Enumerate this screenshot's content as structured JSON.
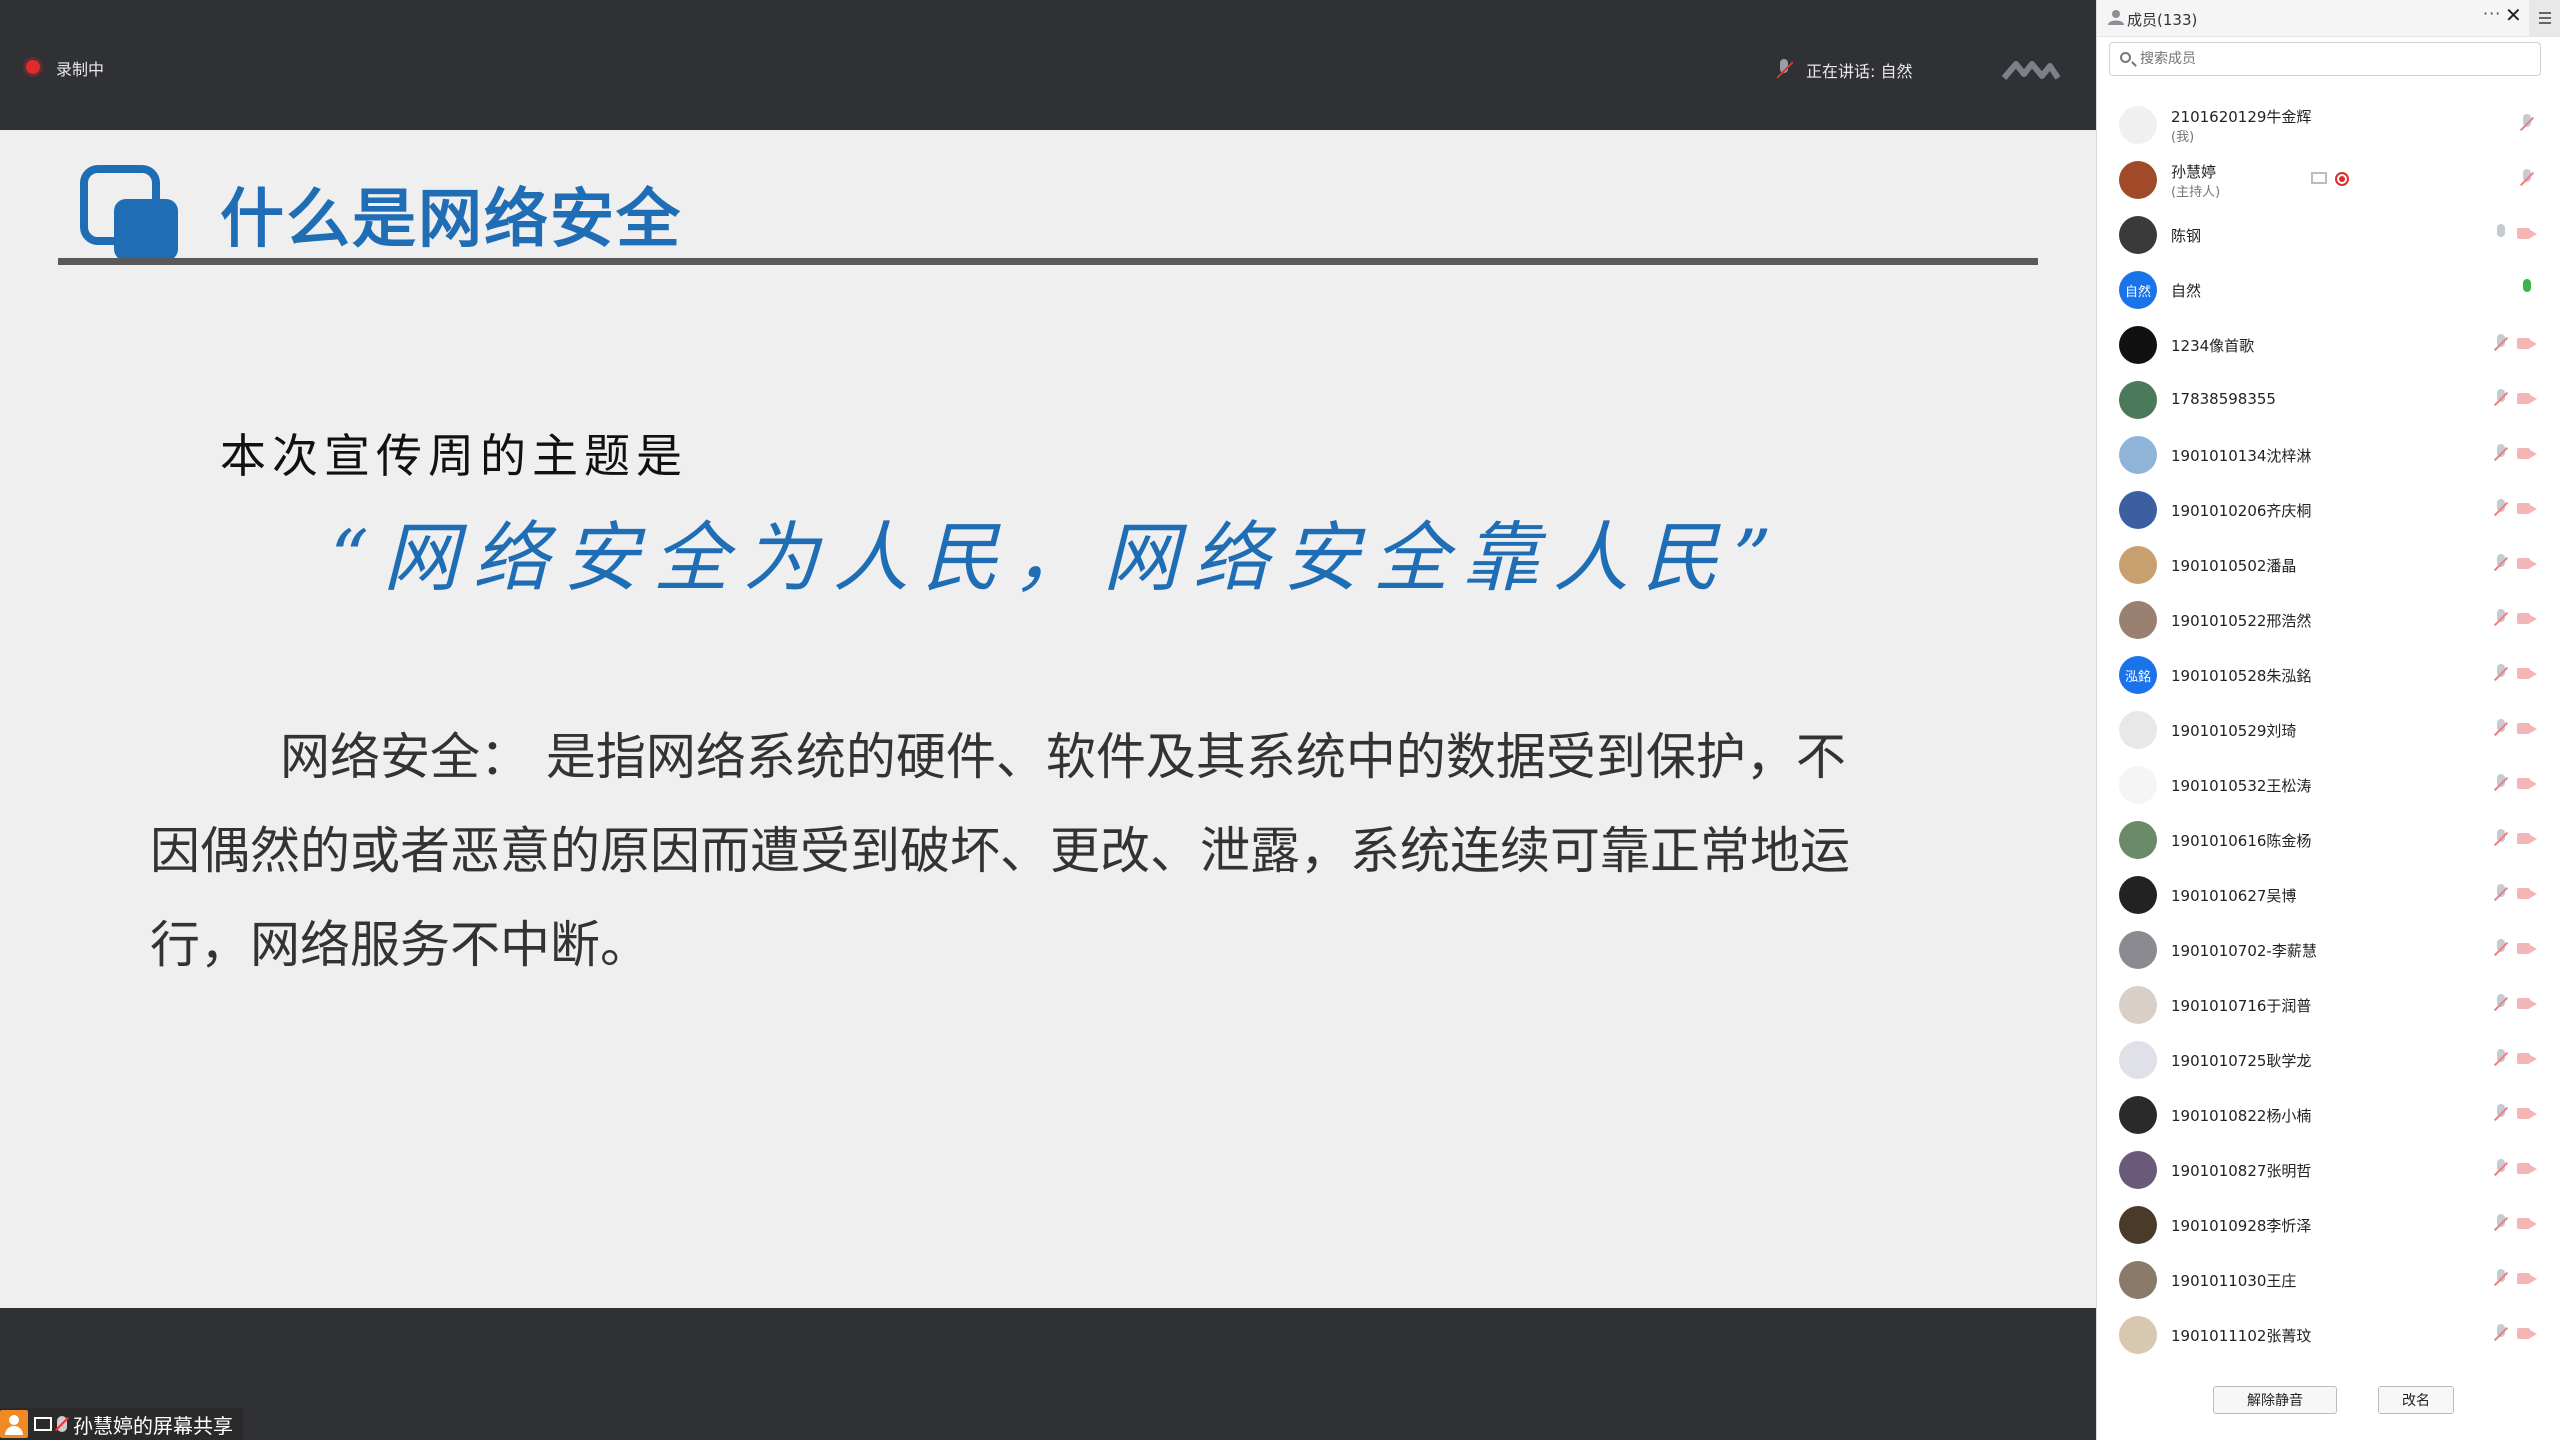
{
  "recording": {
    "label": "录制中"
  },
  "speaking": {
    "label": "正在讲话: 自然"
  },
  "slide": {
    "title": "什么是网络安全",
    "theme_intro": "本次宣传周的主题是",
    "theme_quote": "“网络安全为人民，网络安全靠人民”",
    "definition": "网络安全：  是指网络系统的硬件、软件及其系统中的数据受到保护，不因偶然的或者恶意的原因而遭受到破坏、更改、泄露，系统连续可靠正常地运行，网络服务不中断。",
    "accent_color": "#1f6db5"
  },
  "share_tag": {
    "label": "孙慧婷的屏幕共享"
  },
  "panel": {
    "title": "成员(133)",
    "more": "···",
    "close": "✕",
    "search_placeholder": "搜索成员",
    "members": [
      {
        "name": "2101620129牛金辉",
        "role": "(我)",
        "avatar": "#f0f0f0"
      },
      {
        "name": "孙慧婷",
        "role": "(主持人)",
        "avatar": "#a04a2a"
      },
      {
        "name": "陈钢",
        "avatar": "#3a3a3a",
        "mic": "plain"
      },
      {
        "name": "自然",
        "avatar": "#1a73e8",
        "avatar_text": "自然",
        "mic": "on"
      },
      {
        "name": "1234像首歌",
        "avatar": "#111111"
      },
      {
        "name": "17838598355",
        "avatar": "#4a7a5a"
      },
      {
        "name": "1901010134沈梓淋",
        "avatar": "#8fb4d8"
      },
      {
        "name": "1901010206齐庆桐",
        "avatar": "#3b5fa0"
      },
      {
        "name": "1901010502潘晶",
        "avatar": "#c8a070"
      },
      {
        "name": "1901010522邢浩然",
        "avatar": "#9a8070"
      },
      {
        "name": "1901010528朱泓銘",
        "avatar": "#1a73e8",
        "avatar_text": "泓銘"
      },
      {
        "name": "1901010529刘琦",
        "avatar": "#e8e8e8"
      },
      {
        "name": "1901010532王松涛",
        "avatar": "#f5f5f5"
      },
      {
        "name": "1901010616陈金杨",
        "avatar": "#6a8a6a"
      },
      {
        "name": "1901010627吴博",
        "avatar": "#222222"
      },
      {
        "name": "1901010702-李薪慧",
        "avatar": "#8a8a90"
      },
      {
        "name": "1901010716于润普",
        "avatar": "#d8d0c8"
      },
      {
        "name": "1901010725耿学龙",
        "avatar": "#e0e0e8"
      },
      {
        "name": "1901010822杨小楠",
        "avatar": "#2a2a2a"
      },
      {
        "name": "1901010827张明哲",
        "avatar": "#6a5a7a"
      },
      {
        "name": "1901010928李忻泽",
        "avatar": "#4a3a2a"
      },
      {
        "name": "1901011030王庄",
        "avatar": "#8a7a6a"
      },
      {
        "name": "1901011102张菁玟",
        "avatar": "#d8c8b0"
      }
    ],
    "buttons": {
      "unmute": "解除静音",
      "rename": "改名"
    }
  }
}
